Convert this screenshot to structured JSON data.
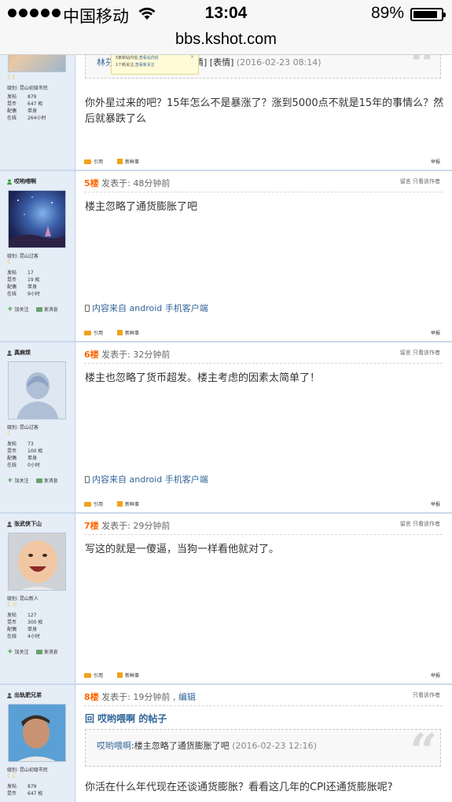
{
  "status_bar": {
    "carrier": "中国移动",
    "time": "13:04",
    "battery_pct": "89%",
    "battery_level": 0.89
  },
  "url_bar": {
    "host": "bbs.kshot.com"
  },
  "post5": {
    "level": "级别: 昆山初级市民",
    "stats": [
      {
        "k": "发帖",
        "v": "879"
      },
      {
        "k": "昆币",
        "v": "647 枚"
      },
      {
        "k": "配偶",
        "v": "单身"
      },
      {
        "k": "在线",
        "v": "264小时"
      }
    ],
    "quote_author": "林芬",
    "quote_tail": "情] [表情]",
    "quote_date": "(2016-02-23 08:14)",
    "tooltip_line1_a": "5条新站内信,",
    "tooltip_line1_b": "查看站内信",
    "tooltip_line2_a": "1个新关注,",
    "tooltip_line2_b": "查看新关注",
    "tooltip_close": "×",
    "body": "你外星过来的吧？15年怎么不是暴涨了？涨到5000点不就是15年的事情么？然后就暴跌了么",
    "quote_label": "引用",
    "fresh_label": "新鲜事",
    "report_label": "举报"
  },
  "post6a": {
    "author": "哎哟喂啊",
    "level": "级别: 昆山过客",
    "stats": [
      {
        "k": "发帖",
        "v": "17"
      },
      {
        "k": "昆币",
        "v": "19 枚"
      },
      {
        "k": "配偶",
        "v": "单身"
      },
      {
        "k": "在线",
        "v": "9小时"
      }
    ],
    "follow": "加关注",
    "message": "发消息",
    "floor": "5楼",
    "posted": "发表于: 48分钟前",
    "right": "留言  只看该作者",
    "body": "楼主忽略了通货膨胀了吧",
    "client": "内容来自 android 手机客户端",
    "quote_label": "引用",
    "fresh_label": "新鲜事",
    "report_label": "举报"
  },
  "post6": {
    "author": "真麻烦",
    "level": "级别: 昆山过客",
    "stats": [
      {
        "k": "发帖",
        "v": "73"
      },
      {
        "k": "昆币",
        "v": "100 枚"
      },
      {
        "k": "配偶",
        "v": "单身"
      },
      {
        "k": "在线",
        "v": "0小时"
      }
    ],
    "follow": "加关注",
    "message": "发消息",
    "floor": "6楼",
    "posted": "发表于: 32分钟前",
    "right": "留言  只看该作者",
    "body": "楼主也忽略了货币超发。楼主考虑的因素太简单了！",
    "client": "内容来自 android 手机客户端",
    "quote_label": "引用",
    "fresh_label": "新鲜事",
    "report_label": "举报"
  },
  "post7": {
    "author": "张武侠下山",
    "level": "级别: 昆山新人",
    "stats": [
      {
        "k": "发帖",
        "v": "127"
      },
      {
        "k": "昆币",
        "v": "300 枚"
      },
      {
        "k": "配偶",
        "v": "单身"
      },
      {
        "k": "在线",
        "v": "4小时"
      }
    ],
    "follow": "加关注",
    "message": "发消息",
    "floor": "7楼",
    "posted": "发表于: 29分钟前",
    "right": "留言  只看该作者",
    "body": "写这的就是一傻逼，当狗一样看他就对了。",
    "quote_label": "引用",
    "fresh_label": "新鲜事",
    "report_label": "举报"
  },
  "post8": {
    "author": "出轨肥兄弟",
    "level": "级别: 昆山初级市民",
    "stats": [
      {
        "k": "发帖",
        "v": "879"
      },
      {
        "k": "昆币",
        "v": "647 枚"
      }
    ],
    "floor": "8楼",
    "posted": "发表于: 19分钟前 ,",
    "edit": "编辑",
    "right": "只看该作者",
    "reply_title": "回 哎哟喂啊 的帖子",
    "quote_author": "哎哟喂啊",
    "quote_text": ":楼主忽略了通货膨胀了吧",
    "quote_date": "(2016-02-23 12:16)",
    "body": "你活在什么年代现在还谈通货膨胀？看看这几年的CPI还通货膨胀呢?"
  }
}
